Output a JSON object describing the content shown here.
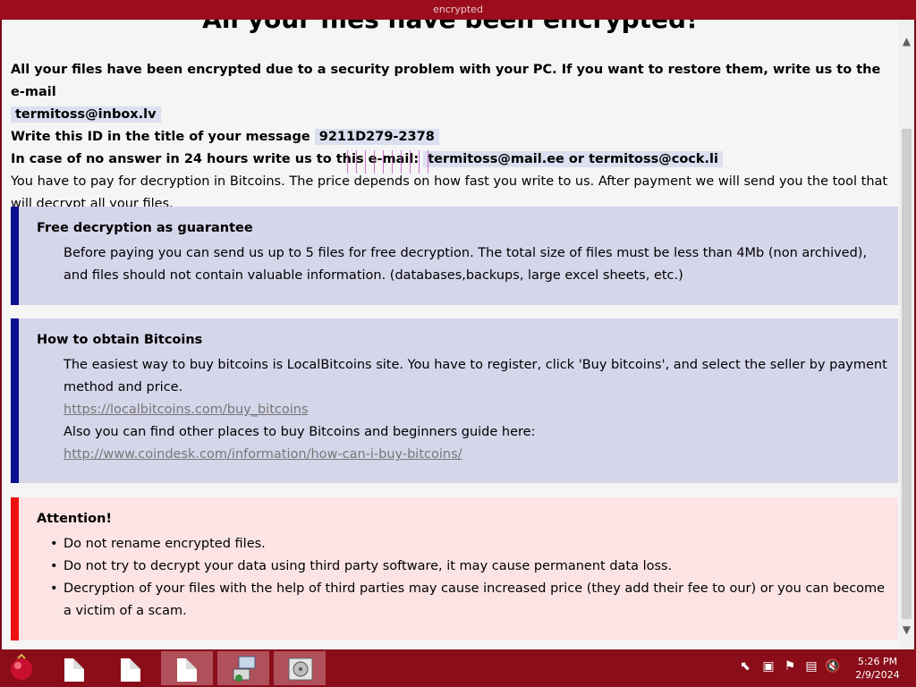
{
  "window": {
    "title": "encrypted"
  },
  "heading": "All your files have been encrypted!",
  "intro": {
    "line1": "All your files have been encrypted due to a security problem with your PC. If you want to restore them, write us to the e-mail",
    "email1": "termitoss@inbox.lv",
    "id_label": "Write this ID in the title of your message",
    "id_value": "9211D279-2378",
    "noanswer_label": "In case of no answer in 24 hours write us to this e-mail:",
    "noanswer_emails": "termitoss@mail.ee or termitoss@cock.li",
    "payment": "You have to pay for decryption in Bitcoins. The price depends on how fast you write to us. After payment we will send you the tool that will decrypt all your files."
  },
  "free_box": {
    "title": "Free decryption as guarantee",
    "text": "Before paying you can send us up to 5 files for free decryption. The total size of files must be less than 4Mb (non archived), and files should not contain valuable information. (databases,backups, large excel sheets, etc.)"
  },
  "bitcoin_box": {
    "title": "How to obtain Bitcoins",
    "text": "The easiest way to buy bitcoins is LocalBitcoins site. You have to register, click 'Buy bitcoins', and select the seller by payment method and price.",
    "link1": "https://localbitcoins.com/buy_bitcoins",
    "text2": "Also you can find other places to buy Bitcoins and beginners guide here:",
    "link2": "http://www.coindesk.com/information/how-can-i-buy-bitcoins/"
  },
  "attention_box": {
    "title": "Attention!",
    "items": [
      "Do not rename encrypted files.",
      "Do not try to decrypt your data using third party software, it may cause permanent data loss.",
      "Decryption of your files with the help of third parties may cause increased price (they add their fee to our) or you can become a victim of a scam."
    ]
  },
  "taskbar": {
    "time": "5:26 PM",
    "date": "2/9/2024",
    "icons": [
      "start-orb-icon",
      "document-icon",
      "document-icon",
      "document-icon",
      "network-setup-icon",
      "disk-icon"
    ],
    "tray_icons": [
      "cursor-icon",
      "network-icon",
      "flag-icon",
      "tray-network-icon",
      "volume-muted-icon"
    ]
  },
  "colors": {
    "accent_blue": "#0c0f8e",
    "accent_red": "#ee1111",
    "taskbar": "#8a0d19",
    "titlebar": "#9b0d1d"
  }
}
